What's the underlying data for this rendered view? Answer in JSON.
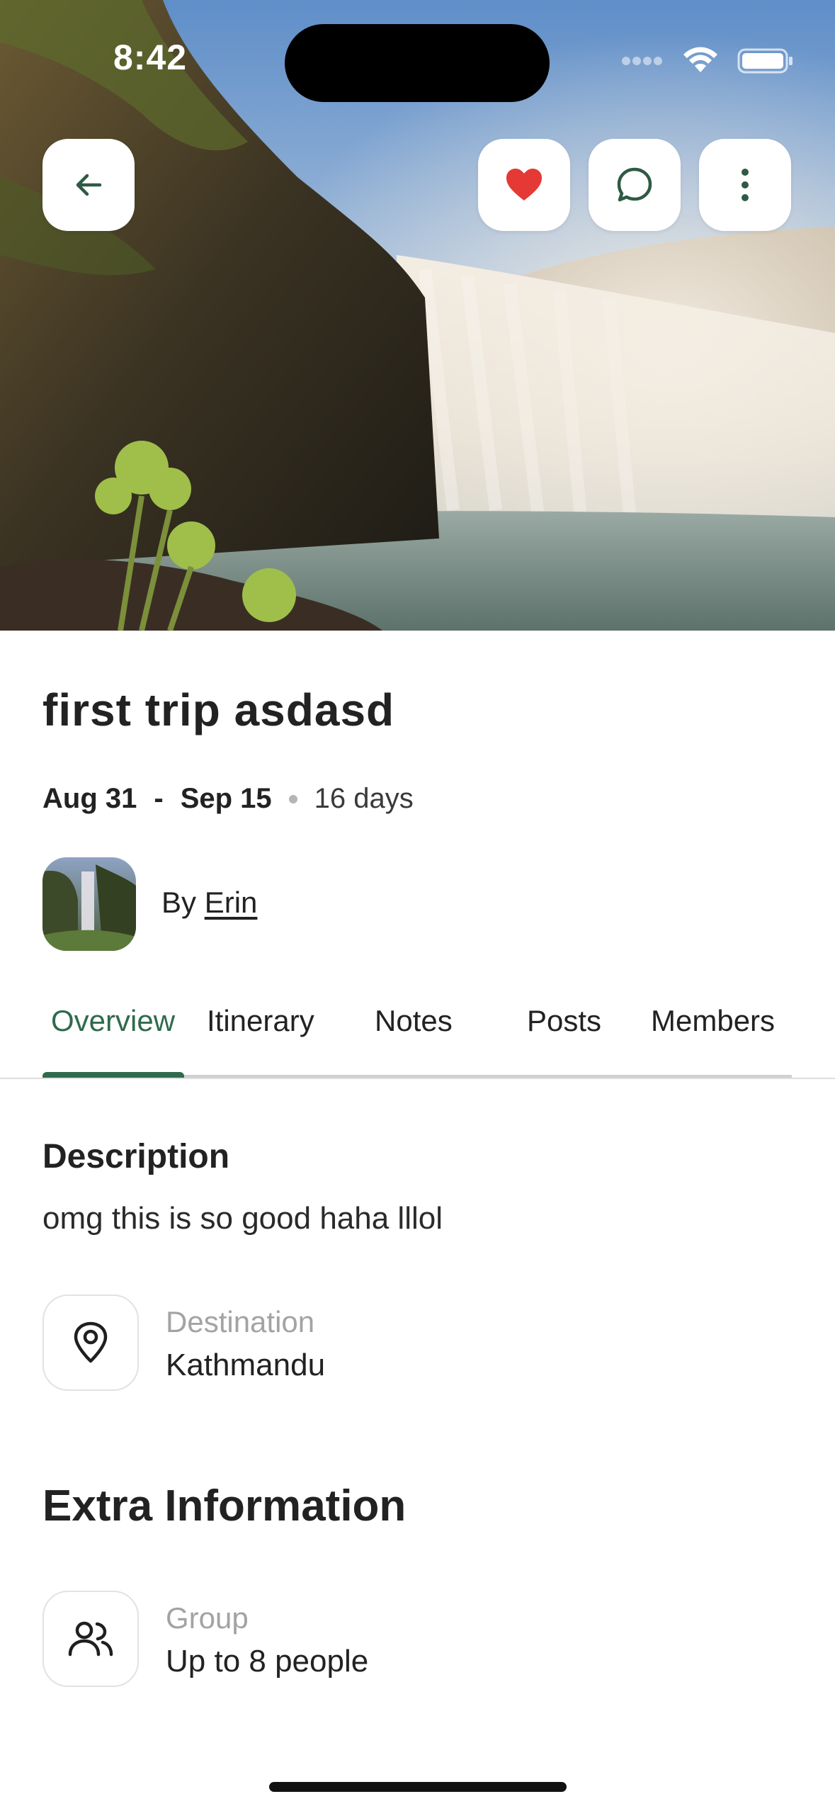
{
  "status_bar": {
    "time": "8:42"
  },
  "header_actions": {
    "back_icon": "arrow-left-icon",
    "like_icon": "heart-icon",
    "chat_icon": "chat-bubble-icon",
    "more_icon": "more-vertical-icon",
    "like_color": "#e53935",
    "icon_color": "#2f5a45"
  },
  "trip": {
    "title": "first trip asdasd",
    "start_date": "Aug 31",
    "date_separator": "-",
    "end_date": "Sep 15",
    "duration": "16 days",
    "by_label": "By",
    "author": "Erin"
  },
  "tabs": [
    {
      "label": "Overview",
      "active": true
    },
    {
      "label": "Itinerary",
      "active": false
    },
    {
      "label": "Notes",
      "active": false
    },
    {
      "label": "Posts",
      "active": false
    },
    {
      "label": "Members",
      "active": false
    }
  ],
  "description": {
    "heading": "Description",
    "text": "omg this is so good haha lllol"
  },
  "destination": {
    "icon": "map-pin-icon",
    "label": "Destination",
    "value": "Kathmandu"
  },
  "extra": {
    "heading": "Extra Information",
    "group": {
      "icon": "users-icon",
      "label": "Group",
      "value": "Up to 8 people"
    }
  },
  "colors": {
    "accent": "#2f6a4d",
    "muted_text": "#a3a3a3"
  }
}
